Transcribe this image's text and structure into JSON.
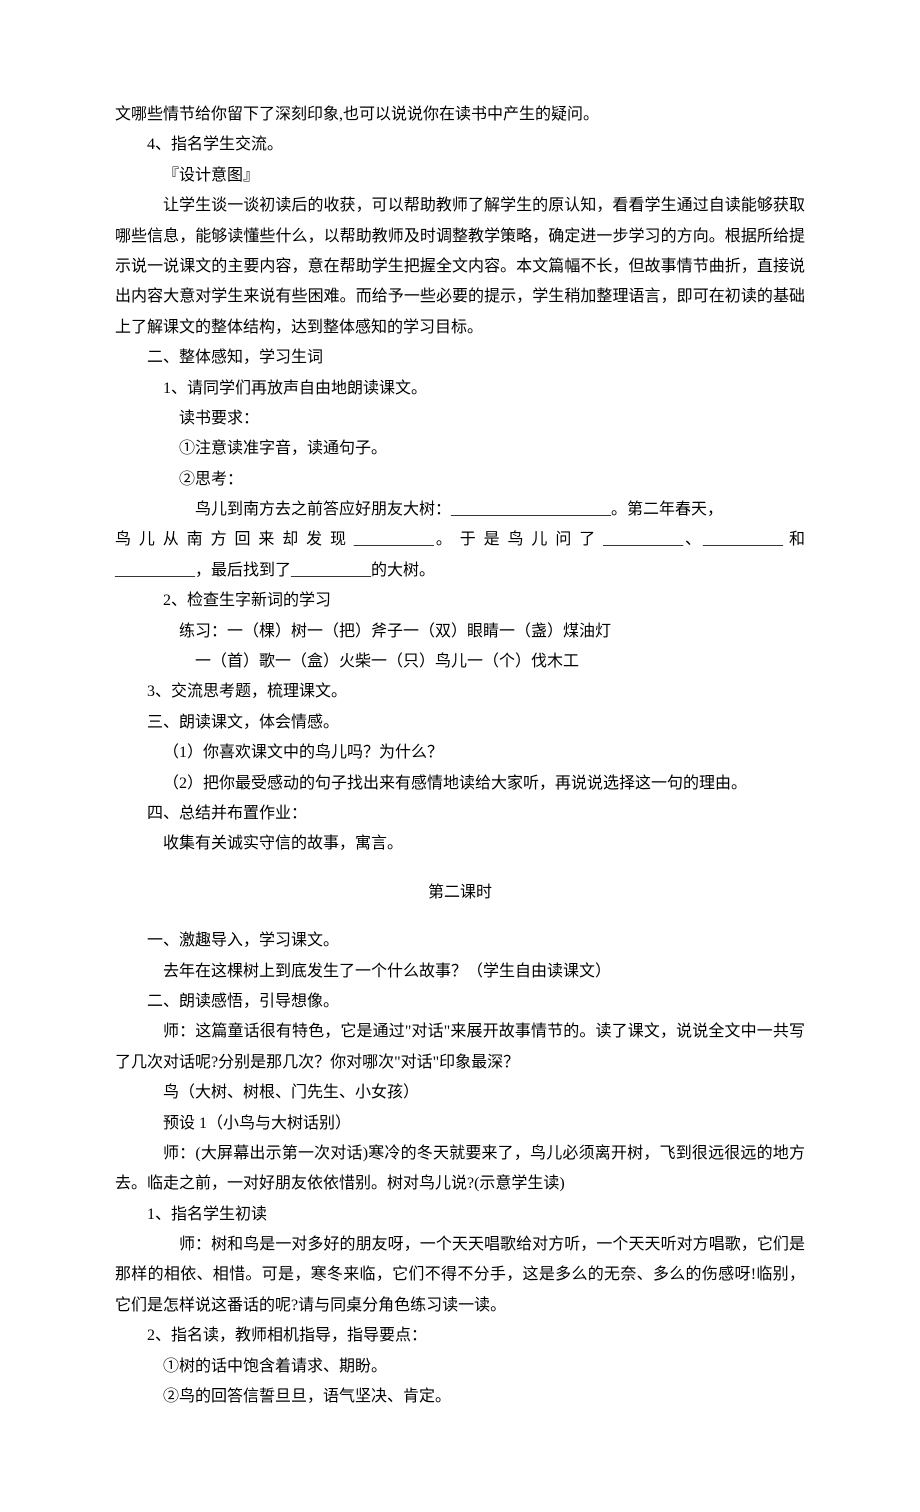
{
  "p1": "文哪些情节给你留下了深刻印象,也可以说说你在读书中产生的疑问。",
  "p2": "4、指名学生交流。",
  "p3": "『设计意图』",
  "p4": "让学生谈一谈初读后的收获，可以帮助教师了解学生的原认知，看看学生通过自读能够获取哪些信息，能够读懂些什么，以帮助教师及时调整教学策略，确定进一步学习的方向。根据所给提示说一说课文的主要内容，意在帮助学生把握全文内容。本文篇幅不长，但故事情节曲折，直接说出内容大意对学生来说有些困难。而给予一些必要的提示，学生稍加整理语言，即可在初读的基础上了解课文的整体结构，达到整体感知的学习目标。",
  "s2_title": "二、整体感知，学习生词",
  "s2_1": "1、请同学们再放声自由地朗读课文。",
  "s2_1a": "读书要求：",
  "s2_1b": "①注意读准字音，读通句子。",
  "s2_1c": "②思考：",
  "s2_1d_1": "鸟儿到南方去之前答应好朋友大树：",
  "s2_1d_blank1": "____________________",
  "s2_1d_2": "。第二年春天，",
  "s2_1e_1": "鸟 儿 从 南 方 回 来 却 发 现 ",
  "s2_1e_blank1": "__________",
  "s2_1e_2": "。 于 是 鸟 儿 问 了 ",
  "s2_1e_blank2": "__________",
  "s2_1e_3": "、",
  "s2_1e_blank3": "__________",
  "s2_1e_4": " 和",
  "s2_1f_blank1": "__________",
  "s2_1f_1": "，最后找到了",
  "s2_1f_blank2": "__________",
  "s2_1f_2": "的大树。",
  "s2_2": "2、检查生字新词的学习",
  "s2_2a": "练习：一（棵）树一（把）斧子一（双）眼睛一（盏）煤油灯",
  "s2_2b": "一（首）歌一（盒）火柴一（只）鸟儿一（个）伐木工",
  "s2_3": "3、交流思考题，梳理课文。",
  "s3_title": "三、朗读课文，体会情感。",
  "s3_1": "（1）你喜欢课文中的鸟儿吗？为什么？",
  "s3_2": "（2）把你最受感动的句子找出来有感情地读给大家听，再说说选择这一句的理由。",
  "s4_title": "四、总结并布置作业：",
  "s4_1": "收集有关诚实守信的故事，寓言。",
  "lesson2_title": "第二课时",
  "l2_s1_title": "一、激趣导入，学习课文。",
  "l2_s1_1": "去年在这棵树上到底发生了一个什么故事？（学生自由读课文）",
  "l2_s2_title": "二、朗读感悟，引导想像。",
  "l2_s2_1": "师：这篇童话很有特色，它是通过\"对话\"来展开故事情节的。读了课文，说说全文中一共写了几次对话呢?分别是那几次？你对哪次\"对话\"印象最深？",
  "l2_s2_2": "鸟（大树、树根、门先生、小女孩）",
  "l2_s2_3": "预设 1（小鸟与大树话别）",
  "l2_s2_4": "师：(大屏幕出示第一次对话)寒冷的冬天就要来了，鸟儿必须离开树，飞到很远很远的地方去。临走之前，一对好朋友依依惜别。树对鸟儿说?(示意学生读)",
  "l2_s2_item1": "1、指名学生初读",
  "l2_s2_item1a": "师：树和鸟是一对多好的朋友呀，一个天天唱歌给对方听，一个天天听对方唱歌，它们是那样的相依、相惜。可是，寒冬来临，它们不得不分手，这是多么的无奈、多么的伤感呀!临别，它们是怎样说这番话的呢?请与同桌分角色练习读一读。",
  "l2_s2_item2": "2、指名读，教师相机指导，指导要点：",
  "l2_s2_item2a": "①树的话中饱含着请求、期盼。",
  "l2_s2_item2b": "②鸟的回答信誓旦旦，语气坚决、肯定。"
}
